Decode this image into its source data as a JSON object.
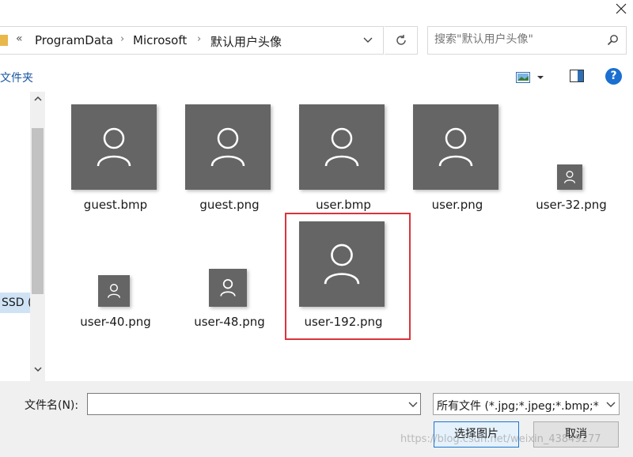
{
  "window": {
    "close_icon": "close-icon"
  },
  "addressbar": {
    "overflow_symbol": "«",
    "breadcrumbs": [
      "ProgramData",
      "Microsoft",
      "默认用户头像"
    ],
    "separator": "›"
  },
  "search": {
    "placeholder": "搜索\"默认用户头像\""
  },
  "toolbar": {
    "new_folder_label": "文件夹",
    "help_label": "?"
  },
  "navpane": {
    "ssd_label": "SSD ("
  },
  "files": [
    {
      "name": "guest.bmp",
      "size": "large"
    },
    {
      "name": "guest.png",
      "size": "large"
    },
    {
      "name": "user.bmp",
      "size": "large"
    },
    {
      "name": "user.png",
      "size": "large"
    },
    {
      "name": "user-32.png",
      "size": "small"
    },
    {
      "name": "user-40.png",
      "size": "small"
    },
    {
      "name": "user-48.png",
      "size": "medium"
    },
    {
      "name": "user-192.png",
      "size": "large",
      "selected": true
    }
  ],
  "bottom": {
    "filename_label": "文件名(N):",
    "filename_value": "",
    "filetype_value": "所有文件 (*.jpg;*.jpeg;*.bmp;*",
    "open_label": "选择图片",
    "cancel_label": "取消",
    "watermark": "https://blog.csdn.net/weixin_43849277"
  },
  "colors": {
    "thumb": "#656565",
    "selection_border": "#d9343a",
    "accent": "#1a76d1"
  }
}
